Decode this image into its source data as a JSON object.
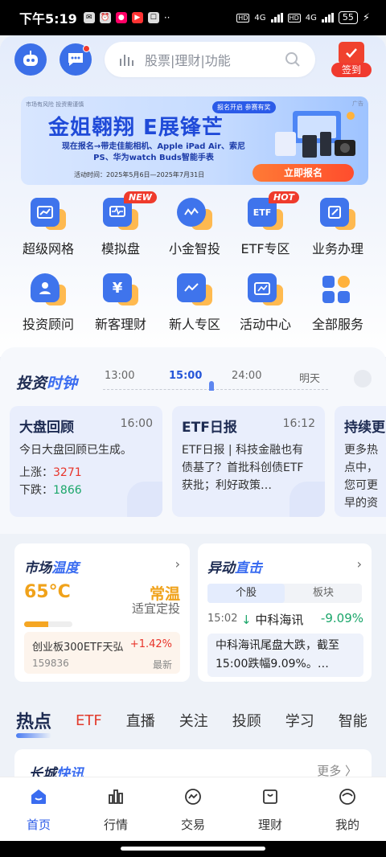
{
  "status_bar": {
    "time": "下午5:19",
    "network_1": "4G",
    "network_2": "4G",
    "battery": "55"
  },
  "header": {
    "search_placeholder": "股票|理财|功能",
    "signin_label": "签到"
  },
  "banner": {
    "risk_note": "市场有风险  投资需谨慎",
    "ad_tag": "广告",
    "badge": "报名开启 参赛有奖",
    "title": "金姐翱翔 E展锋芒",
    "subtitle": "现在报名→带走佳能相机、Apple iPad Air、索尼PS、华为watch Buds智能手表",
    "date": "活动时间：2025年5月6日—2025年7月31日",
    "button": "立即报名"
  },
  "grid": {
    "row1": [
      {
        "label": "超级网格",
        "badge": ""
      },
      {
        "label": "模拟盘",
        "badge": "NEW"
      },
      {
        "label": "小金智投",
        "badge": ""
      },
      {
        "label": "ETF专区",
        "badge": "HOT"
      },
      {
        "label": "业务办理",
        "badge": ""
      }
    ],
    "row2": [
      {
        "label": "投资顾问"
      },
      {
        "label": "新客理财"
      },
      {
        "label": "新人专区"
      },
      {
        "label": "活动中心"
      },
      {
        "label": "全部服务"
      }
    ]
  },
  "clock": {
    "title_a": "投资",
    "title_b": "时钟",
    "timeline": [
      "13:00",
      "15:00",
      "24:00",
      "明天"
    ],
    "cards": [
      {
        "title": "大盘回顾",
        "time": "16:00",
        "line1": "今日大盘回顾已生成。",
        "up_label": "上涨：",
        "up_value": "3271",
        "down_label": "下跌：",
        "down_value": "1866"
      },
      {
        "title": "ETF日报",
        "time": "16:12",
        "body": "ETF日报 | 科技金融也有债基了？首批科创债ETF获批；利好政策…"
      },
      {
        "title": "持续更",
        "body": "更多热点中，您可更早的资"
      }
    ]
  },
  "market_temp": {
    "title_a": "市场",
    "title_b": "温度",
    "temperature": "65°C",
    "state": "常温",
    "advice": "适宜定投",
    "level": 0.5,
    "fund_name": "创业板300ETF天弘",
    "fund_change": "+1.42%",
    "fund_code": "159836",
    "fund_tag": "最新"
  },
  "alerts": {
    "title_a": "异动",
    "title_b": "直击",
    "seg_stock": "个股",
    "seg_sector": "板块",
    "time": "15:02",
    "arrow": "↓",
    "name": "中科海讯",
    "change": "-9.09%",
    "desc": "中科海讯尾盘大跌，截至15:00跌幅9.09%。…"
  },
  "tabs": [
    "热点",
    "ETF",
    "直播",
    "关注",
    "投顾",
    "学习",
    "智能"
  ],
  "news": {
    "title_a": "长城",
    "title_b": "快讯",
    "more": "更多 〉"
  },
  "bottom_nav": [
    {
      "label": "首页",
      "icon": "home-icon"
    },
    {
      "label": "行情",
      "icon": "market-icon"
    },
    {
      "label": "交易",
      "icon": "trade-icon"
    },
    {
      "label": "理财",
      "icon": "wealth-icon"
    },
    {
      "label": "我的",
      "icon": "profile-icon"
    }
  ],
  "colors": {
    "brand_blue": "#3a6cf0",
    "red": "#e8342a",
    "green": "#1aa66a",
    "orange": "#f0a21a"
  }
}
